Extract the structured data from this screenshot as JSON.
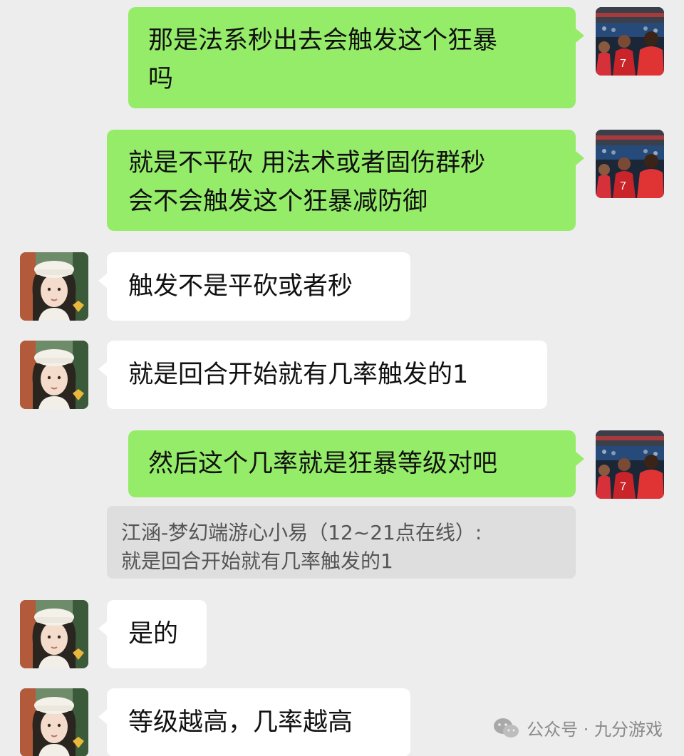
{
  "messages": [
    {
      "side": "right",
      "text": "那是法系秒出去会触发这个狂暴\n吗"
    },
    {
      "side": "right",
      "text": "就是不平砍 用法术或者固伤群秒\n会不会触发这个狂暴减防御"
    },
    {
      "side": "left",
      "text": "触发不是平砍或者秒"
    },
    {
      "side": "left",
      "text": "就是回合开始就有几率触发的1"
    },
    {
      "side": "right",
      "text": "然后这个几率就是狂暴等级对吧"
    },
    {
      "side": "left",
      "text": "是的"
    },
    {
      "side": "left",
      "text": "等级越高，几率越高"
    }
  ],
  "quote": {
    "line1": "江涵-梦幻端游心小易（12~21点在线）:",
    "line2": "就是回合开始就有几率触发的1"
  },
  "watermark": {
    "text": "公众号 · 九分游戏",
    "icon": "wechat-icon"
  },
  "colors": {
    "background": "#ededed",
    "sent_bubble": "#95ec69",
    "received_bubble": "#ffffff",
    "quote_bg": "#dedede"
  },
  "icons": {
    "sender_avatar": "football-players-avatar",
    "receiver_avatar": "girl-beret-avatar"
  }
}
